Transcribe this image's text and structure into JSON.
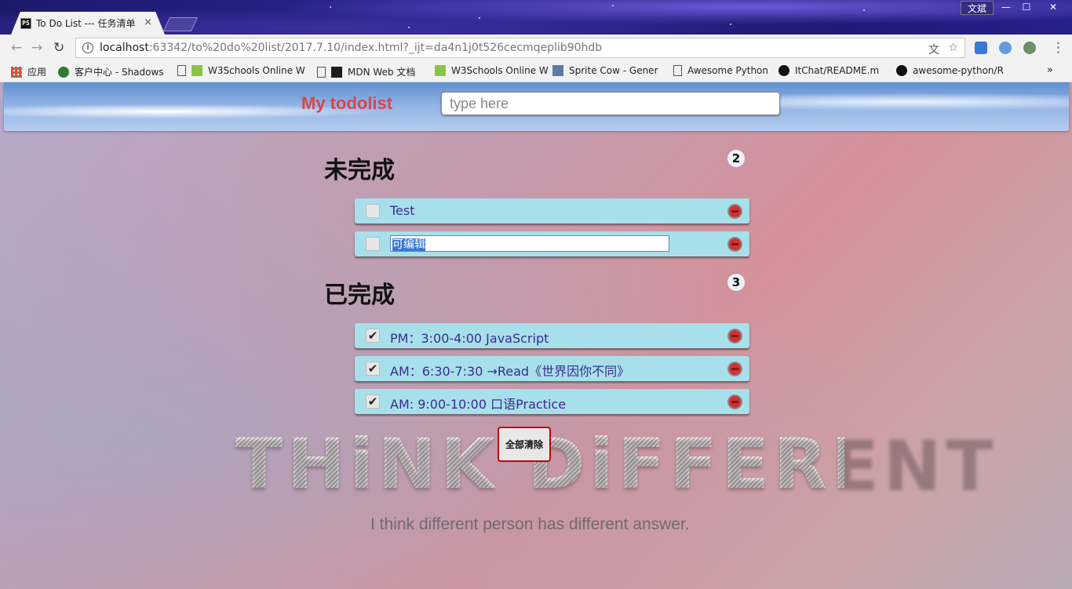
{
  "browser": {
    "tab_title": "To Do List --- 任务清单",
    "tab_favicon_text": "PS",
    "tab_close": "×",
    "user_badge": "文斌",
    "window_buttons": {
      "minimize": "—",
      "maximize": "☐",
      "close": "✕"
    },
    "url_host": "localhost",
    "url_rest": ":63342/to%20do%20list/2017.7.10/index.html?_ijt=da4n1j0t526cecmqeplib90hdb",
    "bookmarks": [
      "应用",
      "客户中心 - Shadows",
      "W3Schools Online W",
      "MDN Web 文档",
      "W3Schools Online W",
      "Sprite Cow - Gener",
      "Awesome Python",
      "ItChat/README.m",
      "awesome-python/R"
    ],
    "bookmarks_more": "»"
  },
  "app": {
    "title": "My todolist",
    "input_placeholder": "type here"
  },
  "sections": {
    "todo": {
      "title": "未完成",
      "count": "2",
      "items": [
        {
          "text": "Test",
          "checked": false
        },
        {
          "text": "可编辑",
          "checked": false,
          "editing": true
        }
      ]
    },
    "done": {
      "title": "已完成",
      "count": "3",
      "items": [
        {
          "text": "PM：3:00-4:00 JavaScript",
          "checked": true
        },
        {
          "text": "AM：6:30-7:30 →Read《世界因你不同》",
          "checked": true
        },
        {
          "text": "AM: 9:00-10:00 口语Practice",
          "checked": true
        }
      ]
    }
  },
  "clear_all": "全部清除",
  "background": {
    "logo_text": "THiNK DiFFERENT",
    "tagline": "I think different person has different answer."
  },
  "check_glyph": "✔"
}
